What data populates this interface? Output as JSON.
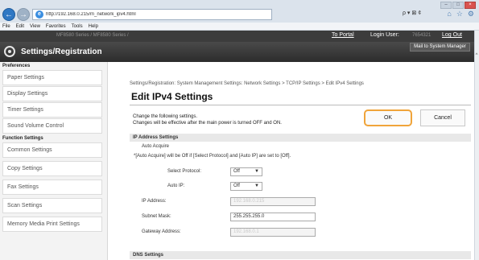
{
  "browser": {
    "url": "http://192.168.0.215/m_network_ipv4.html",
    "address_tools": "ρ ▾ ⊠ ¢",
    "window_buttons": [
      "–",
      "□",
      "×"
    ],
    "menu": [
      "File",
      "Edit",
      "View",
      "Favorites",
      "Tools",
      "Help"
    ]
  },
  "header": {
    "device_name": "MF8580 Series / MF8580 Series /",
    "to_portal": "To Portal",
    "login_label": "Login User:",
    "login_user": "7654321",
    "logout": "Log Out",
    "mail_button": "Mail to System Manager",
    "app_title": "Settings/Registration"
  },
  "sidebar": {
    "preferences_heading": "Preferences",
    "preferences": [
      "Paper Settings",
      "Display Settings",
      "Timer Settings",
      "Sound Volume Control"
    ],
    "function_heading": "Function Settings",
    "functions": [
      "Common Settings",
      "Copy Settings",
      "Fax Settings",
      "Scan Settings",
      "Memory Media Print Settings"
    ]
  },
  "main": {
    "breadcrumb": "Settings/Registration: System Management Settings: Network Settings > TCP/IP Settings > Edit IPv4 Settings",
    "title": "Edit IPv4 Settings",
    "instruction_1": "Change the following settings.",
    "instruction_2": "Changes will be effective after the main power is turned OFF and ON.",
    "ok_label": "OK",
    "cancel_label": "Cancel",
    "ip_section": "IP Address Settings",
    "auto_acquire": "Auto Acquire",
    "auto_acquire_note": "*[Auto Acquire] will be Off if [Select Protocol] and [Auto IP] are set to [Off].",
    "select_protocol_label": "Select Protocol:",
    "select_protocol_value": "Off",
    "auto_ip_label": "Auto IP:",
    "auto_ip_value": "Off",
    "ip_address_label": "IP Address:",
    "ip_address_value": "192.168.0.215",
    "subnet_label": "Subnet Mask:",
    "subnet_value": "255.255.255.0",
    "gateway_label": "Gateway Address:",
    "gateway_value": "192.168.0.1",
    "dns_section": "DNS Settings"
  }
}
